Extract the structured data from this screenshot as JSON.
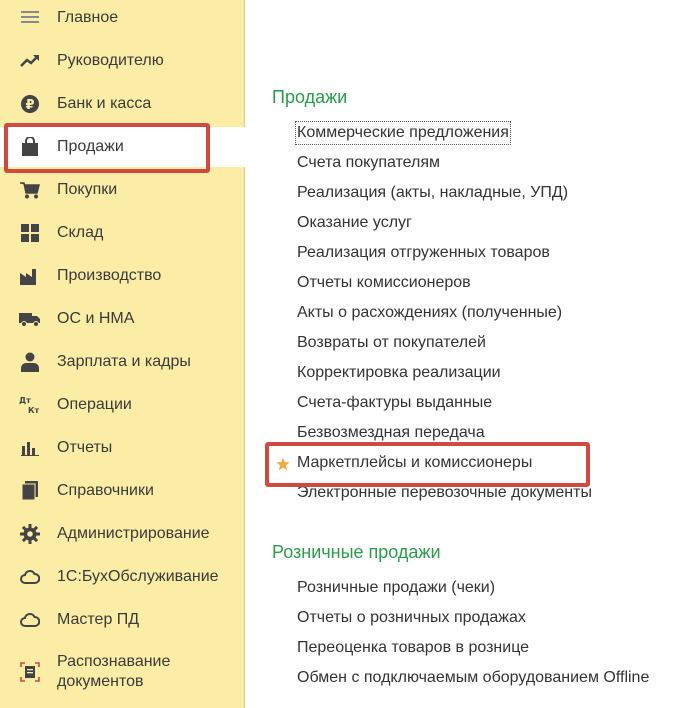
{
  "sidebar": {
    "items": [
      {
        "label": "Главное",
        "icon": "menu-lines-icon"
      },
      {
        "label": "Руководителю",
        "icon": "trend-up-icon"
      },
      {
        "label": "Банк и касса",
        "icon": "ruble-coin-icon"
      },
      {
        "label": "Продажи",
        "icon": "shopping-bag-icon",
        "active": true
      },
      {
        "label": "Покупки",
        "icon": "shopping-cart-icon"
      },
      {
        "label": "Склад",
        "icon": "warehouse-grid-icon"
      },
      {
        "label": "Производство",
        "icon": "factory-icon"
      },
      {
        "label": "ОС и НМА",
        "icon": "truck-icon"
      },
      {
        "label": "Зарплата и кадры",
        "icon": "person-icon"
      },
      {
        "label": "Операции",
        "icon": "dt-kt-icon"
      },
      {
        "label": "Отчеты",
        "icon": "bar-chart-icon"
      },
      {
        "label": "Справочники",
        "icon": "books-icon"
      },
      {
        "label": "Администрирование",
        "icon": "gear-icon"
      },
      {
        "label": "1С:БухОбслуживание",
        "icon": "cloud-icon"
      },
      {
        "label": "Мастер ПД",
        "icon": "cloud-icon"
      },
      {
        "label": "Распознавание документов",
        "icon": "document-scan-icon"
      }
    ]
  },
  "main": {
    "sections": [
      {
        "title": "Продажи",
        "links": [
          "Коммерческие предложения",
          "Счета покупателям",
          "Реализация (акты, накладные, УПД)",
          "Оказание услуг",
          "Реализация отгруженных товаров",
          "Отчеты комиссионеров",
          "Акты о расхождениях (полученные)",
          "Возвраты от покупателей",
          "Корректировка реализации",
          "Счета-фактуры выданные",
          "Безвозмездная передача",
          "Маркетплейсы и комиссионеры",
          "Электронные перевозочные документы"
        ]
      },
      {
        "title": "Розничные продажи",
        "links": [
          "Розничные продажи (чеки)",
          "Отчеты о розничных продажах",
          "Переоценка товаров в рознице",
          "Обмен с подключаемым оборудованием Offline"
        ]
      }
    ],
    "favorite_icon": "star-icon"
  },
  "colors": {
    "sidebar_bg": "#fbeca6",
    "section_title": "#2c9a4b",
    "highlight": "#d04a3f",
    "star": "#f3a83b"
  }
}
